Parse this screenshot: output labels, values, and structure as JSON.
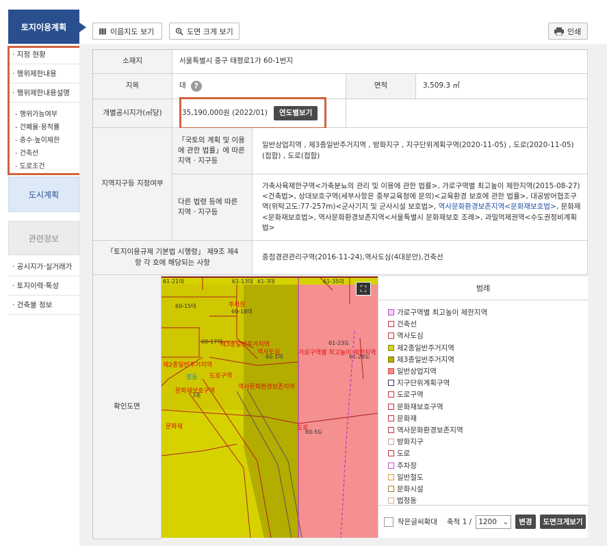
{
  "sidebar": {
    "header": "토지이용계획",
    "items": [
      "· 지정 현황",
      "· 행위제한내용",
      "· 행위제한내용설명"
    ],
    "subitems": [
      "- 행위가능여부",
      "- 건폐율·용적률",
      "- 층수·높이제한",
      "- 건축선",
      "- 도로조건"
    ],
    "dosi": "도시계획",
    "related": "관련정보",
    "related_items": [
      "· 공시지가·실거래가",
      "· 토지이력·특성",
      "· 건축물 정보"
    ]
  },
  "toolbar": {
    "map_btn": "이음지도 보기",
    "zoom_btn": "도면 크게 보기",
    "print_btn": "인쇄"
  },
  "info": {
    "location_label": "소재지",
    "location": "서울특별시 중구 태평로1가 60-1번지",
    "jimok_label": "지목",
    "jimok": "대",
    "area_label": "면적",
    "area": "3,509.3 ㎡",
    "price_label": "개별공시지가(㎡당)",
    "price": "35,190,000원 (2022/01)",
    "price_btn": "연도별보기",
    "zone_label": "지역지구등 지정여부",
    "zone1_label": "「국토의 계획 및 이용에 관한 법률」에 따른 지역 · 지구등",
    "zone1": "일반상업지역 , 제3종일반주거지역 , 방화지구 , 지구단위계획구역(2020-11-05) , 도로(2020-11-05)(접합) , 도로(접합)",
    "zone2_label": "다른 법령 등에 따른 지역 · 지구등",
    "zone2_a": "가축사육제한구역<가축분뇨의 관리 및 이용에 관한 법률>, 가로구역별 최고높이 제한지역(2015-08-27)<건축법>, 상대보호구역(세부사항은 중부교육청에 문의)<교육환경 보호에 관한 법률>, 대공방어협조구역(위탁고도:77-257m)<군사기지 및 군사시설 보호법>, ",
    "zone2_link": "역사문화환경보존지역<문화재보호법>",
    "zone2_b": ", 문화재<문화재보호법>, 역사문화환경보존지역<서울특별시 문화재보호 조례>, 과밀억제권역<수도권정비계획법>",
    "reg_label": "「토지이용규제 기본법 시행령」 제9조 제4항 각 호에 해당되는 사항",
    "reg": "중점경관관리구역(2016-11-24),역사도심(4대문안),건축선",
    "map_label": "확인도면"
  },
  "legend": {
    "title": "범례",
    "items": [
      {
        "label": "가로구역별 최고높이 제한지역",
        "color": "#f3d2f3",
        "border": "#c04ac0"
      },
      {
        "label": "건축선",
        "color": "#ffffff",
        "border": "#c0303a"
      },
      {
        "label": "역사도심",
        "color": "#ffffff",
        "border": "#c0303a"
      },
      {
        "label": "제2종일반주거지역",
        "color": "#d4d12a",
        "border": "#8a8800"
      },
      {
        "label": "제3종일반주거지역",
        "color": "#b3b000",
        "border": "#777400"
      },
      {
        "label": "일반상업지역",
        "color": "#f28a8a",
        "border": "#d05050"
      },
      {
        "label": "지구단위계획구역",
        "color": "#ffffff",
        "border": "#333366"
      },
      {
        "label": "도로구역",
        "color": "#ffffff",
        "border": "#c0303a"
      },
      {
        "label": "문화재보호구역",
        "color": "#ffffff",
        "border": "#c0303a"
      },
      {
        "label": "문화재",
        "color": "#ffffff",
        "border": "#c0303a"
      },
      {
        "label": "역사문화환경보존지역",
        "color": "#ffffff",
        "border": "#c0303a"
      },
      {
        "label": "방화지구",
        "color": "#ffffff",
        "border": "#c8a0a0"
      },
      {
        "label": "도로",
        "color": "#ffffff",
        "border": "#c0303a"
      },
      {
        "label": "주차장",
        "color": "#ffffff",
        "border": "#c04ac0"
      },
      {
        "label": "일반철도",
        "color": "#ffffff",
        "border": "#d0a040"
      },
      {
        "label": "문화시설",
        "color": "#ffffff",
        "border": "#a08030"
      },
      {
        "label": "법정동",
        "color": "#ffffff",
        "border": "#c8b090"
      }
    ],
    "small_text": "작은글씨확대",
    "scale_label": "축척 1 /",
    "scale_value": "1200",
    "change_btn": "변경",
    "big_btn": "도면크게보기"
  },
  "map": {
    "parcels": [
      "61-21대",
      "61-13대",
      "61-3대",
      "61-35대",
      "60-15대",
      "60-18대",
      "60-17대",
      "60-1대",
      "61-29도",
      "3종",
      "60-5도",
      "61-23도"
    ],
    "labels": [
      "주차장",
      "제3종일반주거지역",
      "역사도심",
      "가로구역별 최고높이 제한지역",
      "제2종일반주거지역",
      "정동",
      "도로구역",
      "문화재보호구역",
      "역사문화환경보존지역",
      "문화재",
      "도로"
    ]
  }
}
